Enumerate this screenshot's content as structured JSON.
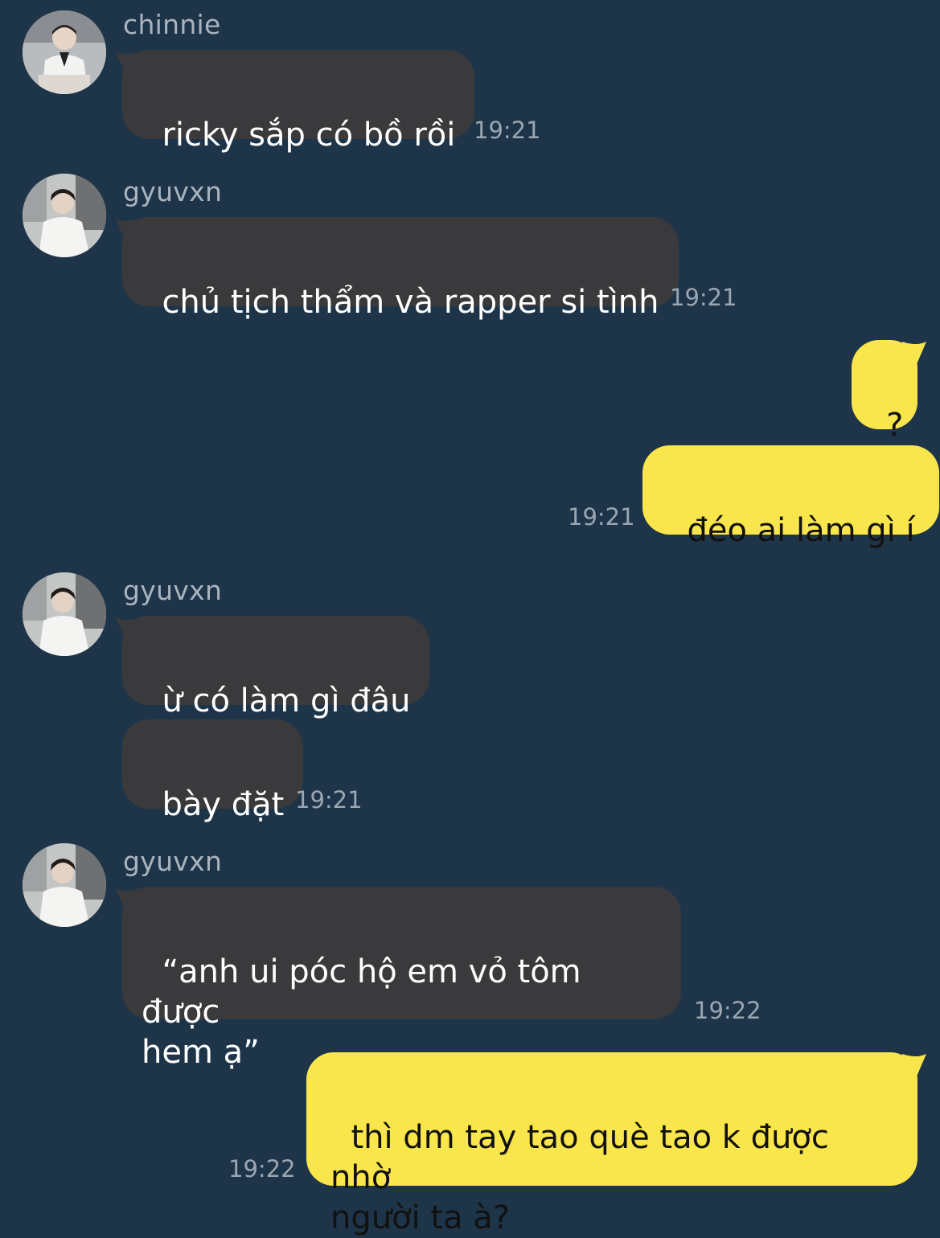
{
  "colors": {
    "background": "#1e3549",
    "incoming_bubble": "#3a3a3c",
    "outgoing_bubble": "#f9e54c",
    "sender_name": "#a9b4bf",
    "timestamp": "#9aa6b2"
  },
  "messages": [
    {
      "sender": "chinnie",
      "text": "ricky sắp có bồ rồi",
      "time": "19:21"
    },
    {
      "sender": "gyuvxn",
      "text": "chủ tịch thẩm và rapper si tình",
      "time": "19:21"
    },
    {
      "text": "?"
    },
    {
      "text": "đéo ai làm gì í",
      "time": "19:21"
    },
    {
      "sender": "gyuvxn",
      "text": "ừ có làm gì đâu"
    },
    {
      "text": "bày đặt",
      "time": "19:21"
    },
    {
      "sender": "gyuvxn",
      "text": "“anh ui póc hộ em vỏ tôm được\nhem ạ”",
      "time": "19:22"
    },
    {
      "text": "thì dm tay tao què tao k được nhờ\nngười ta à?",
      "time": "19:22"
    }
  ]
}
